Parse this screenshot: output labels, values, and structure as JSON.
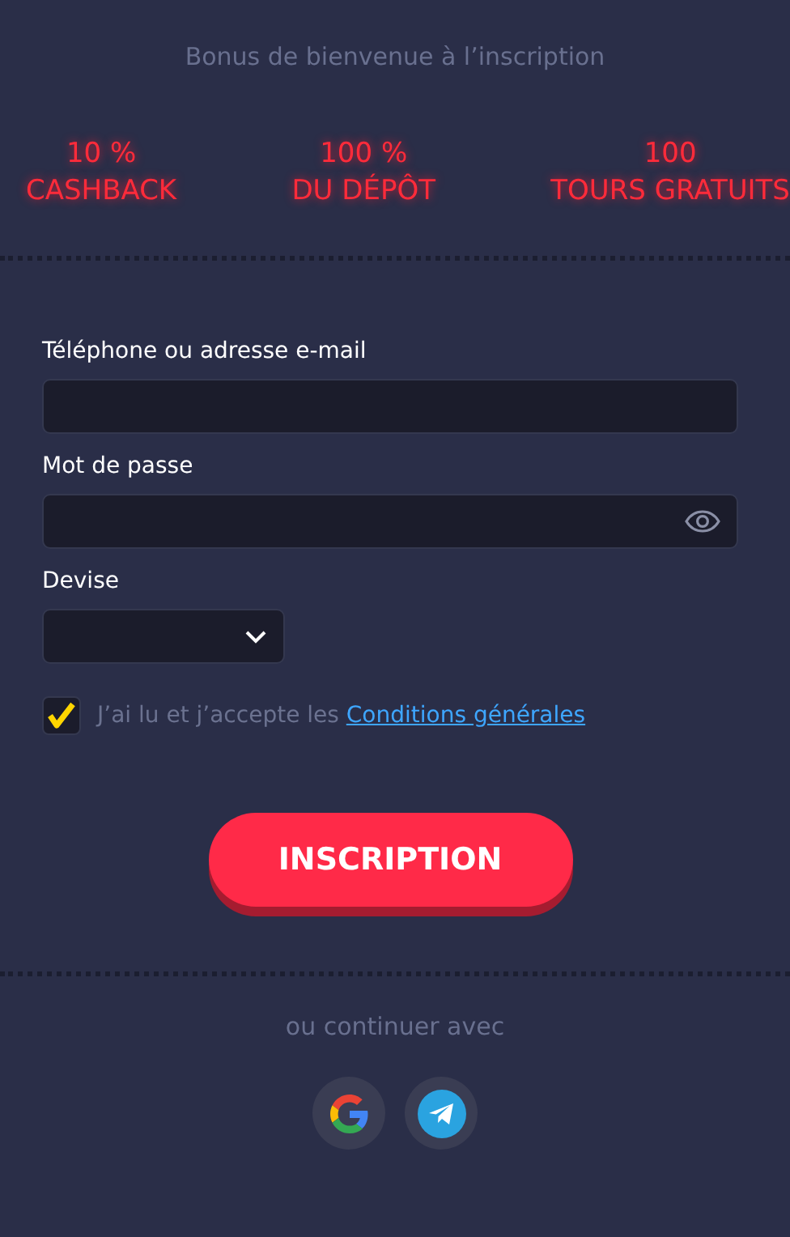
{
  "heading": "Bonus de bienvenue à l’inscription",
  "bonuses": [
    {
      "amount": "10 %",
      "label": "CASHBACK"
    },
    {
      "amount": "100 %",
      "label": "DU DÉPÔT"
    },
    {
      "amount": "100",
      "label": "TOURS GRATUITS"
    }
  ],
  "fields": [
    {
      "kind": "text",
      "label": "Téléphone ou adresse e-mail"
    },
    {
      "kind": "password",
      "label": "Mot de passe"
    },
    {
      "kind": "select",
      "label": "Devise"
    }
  ],
  "terms": {
    "checked": true,
    "text": "J’ai lu et j’accepte les",
    "link": "Conditions générales"
  },
  "submit": "INSCRIPTION",
  "alt_heading": "ou continuer avec",
  "social_buttons": [
    {
      "kind": "google"
    },
    {
      "kind": "telegram"
    }
  ]
}
